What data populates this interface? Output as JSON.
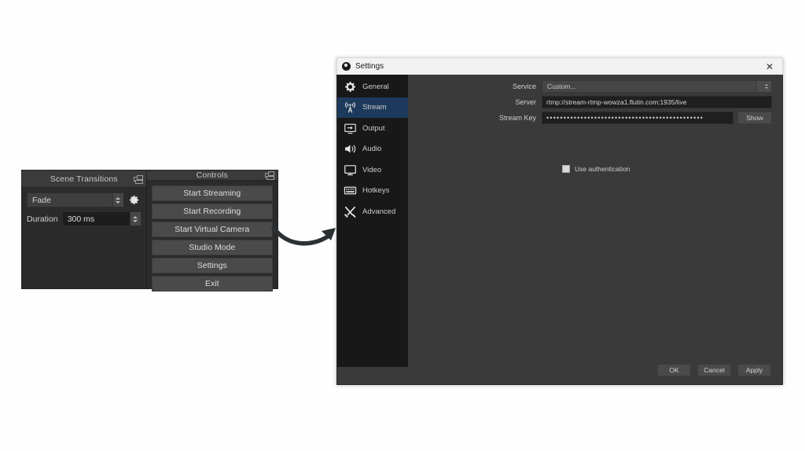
{
  "docks": {
    "scene_transitions": {
      "title": "Scene Transitions",
      "float_icon": "undock-icon",
      "transition": {
        "selected": "Fade",
        "gear_icon": "gear-icon"
      },
      "duration": {
        "label": "Duration",
        "value": "300 ms"
      }
    },
    "controls": {
      "title": "Controls",
      "float_icon": "undock-icon",
      "buttons": [
        {
          "label": "Start Streaming"
        },
        {
          "label": "Start Recording"
        },
        {
          "label": "Start Virtual Camera"
        },
        {
          "label": "Studio Mode"
        },
        {
          "label": "Settings"
        },
        {
          "label": "Exit"
        }
      ]
    }
  },
  "arrow": {
    "name": "curved-arrow-icon",
    "color": "#2b3033"
  },
  "settings_window": {
    "titlebar": {
      "title": "Settings",
      "logo_icon": "obs-logo-icon",
      "close_icon": "close-icon",
      "close_glyph": "✕"
    },
    "sidebar": {
      "items": [
        {
          "label": "General",
          "icon": "gear-icon",
          "selected": false
        },
        {
          "label": "Stream",
          "icon": "broadcast-icon",
          "selected": true
        },
        {
          "label": "Output",
          "icon": "output-icon",
          "selected": false
        },
        {
          "label": "Audio",
          "icon": "speaker-icon",
          "selected": false
        },
        {
          "label": "Video",
          "icon": "monitor-icon",
          "selected": false
        },
        {
          "label": "Hotkeys",
          "icon": "keyboard-icon",
          "selected": false
        },
        {
          "label": "Advanced",
          "icon": "tools-icon",
          "selected": false
        }
      ],
      "selected_color": "#1d3a5c"
    },
    "stream_page": {
      "service": {
        "label": "Service",
        "value": "Custom...",
        "spinner_icon": "updown-spinner-icon"
      },
      "server": {
        "label": "Server",
        "value": "rtmp://stream-rtmp-wowza1.flutin.com:1935/live"
      },
      "stream_key": {
        "label": "Stream Key",
        "value": "••••••••••••••••••••••••••••••••••••••••••••••",
        "show_button": "Show"
      },
      "use_authentication": {
        "label": "Use authentication",
        "checked": false
      }
    },
    "footer": {
      "ok": "OK",
      "cancel": "Cancel",
      "apply": "Apply"
    }
  }
}
